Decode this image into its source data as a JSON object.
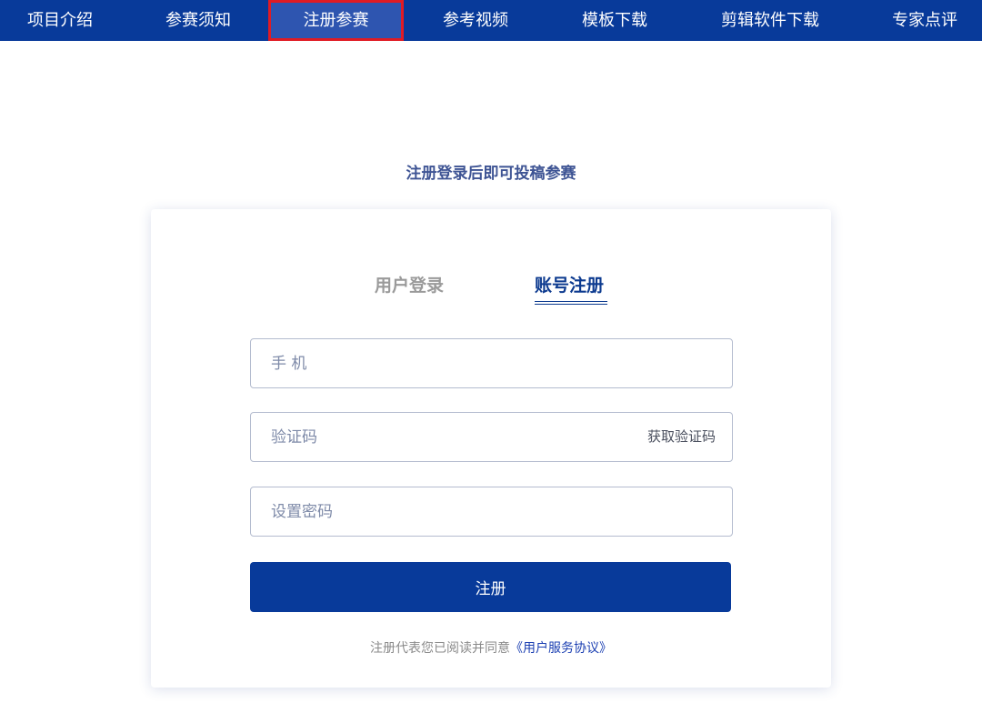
{
  "nav": {
    "items": [
      {
        "label": "项目介绍"
      },
      {
        "label": "参赛须知"
      },
      {
        "label": "注册参赛",
        "active": true
      },
      {
        "label": "参考视频"
      },
      {
        "label": "模板下载"
      },
      {
        "label": "剪辑软件下载"
      },
      {
        "label": "专家点评"
      }
    ]
  },
  "page": {
    "subtitle": "注册登录后即可投稿参赛"
  },
  "tabs": {
    "login": "用户登录",
    "register": "账号注册",
    "active": "register"
  },
  "form": {
    "phone_placeholder": "手 机",
    "phone_value": "",
    "code_placeholder": "验证码",
    "code_value": "",
    "get_code_label": "获取验证码",
    "password_placeholder": "设置密码",
    "password_value": "",
    "submit_label": "注册"
  },
  "agreement": {
    "text": "注册代表您已阅读并同意",
    "link": "《用户服务协议》"
  },
  "colors": {
    "nav_bg": "#083a9a",
    "active_nav_bg": "#2e55b0",
    "active_nav_border": "#e01b24",
    "accent": "#0c3a8f",
    "link": "#1b3fb2"
  }
}
